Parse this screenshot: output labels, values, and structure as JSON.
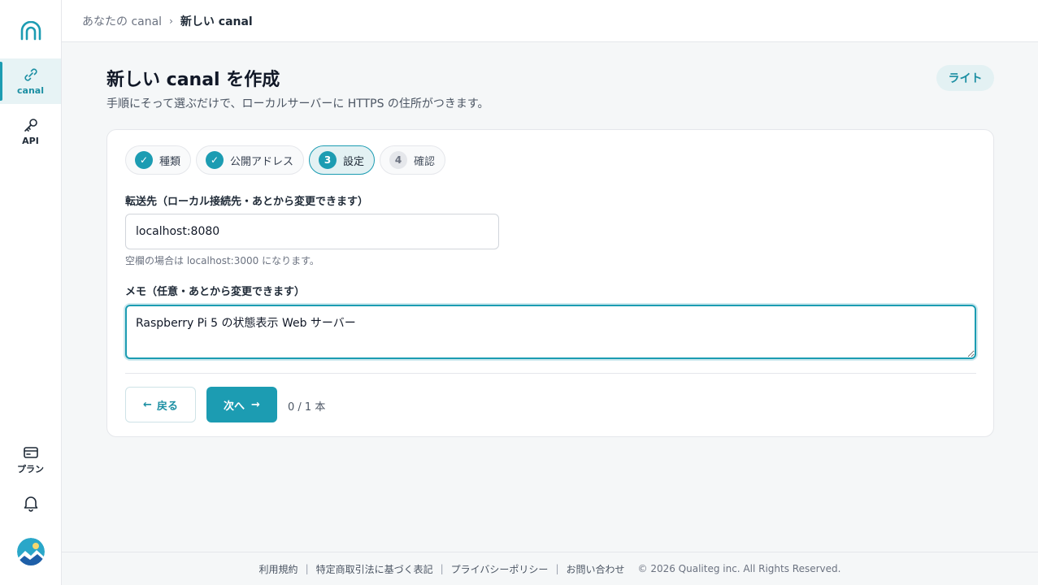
{
  "sidebar": {
    "items": [
      {
        "label": "canal",
        "icon": "link-icon",
        "active": true
      },
      {
        "label": "API",
        "icon": "key-icon",
        "active": false
      }
    ],
    "bottom_items": [
      {
        "label": "プラン",
        "icon": "card-icon"
      }
    ]
  },
  "breadcrumb": {
    "parent": "あなたの canal",
    "separator": "›",
    "current": "新しい canal"
  },
  "header": {
    "title": "新しい canal を作成",
    "subtitle": "手順にそって選ぶだけで、ローカルサーバーに HTTPS の住所がつきます。",
    "plan_badge": "ライト"
  },
  "steps": [
    {
      "marker": "✓",
      "label": "種類",
      "state": "done"
    },
    {
      "marker": "✓",
      "label": "公開アドレス",
      "state": "done"
    },
    {
      "marker": "3",
      "label": "設定",
      "state": "current"
    },
    {
      "marker": "4",
      "label": "確認",
      "state": "pending"
    }
  ],
  "form": {
    "forward_label": "転送先（ローカル接続先・あとから変更できます）",
    "forward_value": "localhost:8080",
    "forward_hint": "空欄の場合は localhost:3000 になります。",
    "memo_label": "メモ（任意・あとから変更できます）",
    "memo_value": "Raspberry Pi 5 の状態表示 Web サーバー"
  },
  "actions": {
    "back_label": "戻る",
    "back_icon": "←",
    "next_label": "次へ",
    "next_icon": "→",
    "count_text": "0 / 1 本"
  },
  "footer": {
    "links": [
      "利用規約",
      "特定商取引法に基づく表記",
      "プライバシーポリシー",
      "お問い合わせ"
    ],
    "copyright": "© 2026 Qualiteg inc. All Rights Reserved."
  },
  "colors": {
    "accent": "#1c9cb2",
    "accent_soft": "#e3f1f3",
    "background": "#f5f7f8"
  }
}
